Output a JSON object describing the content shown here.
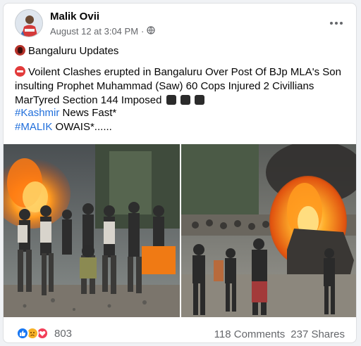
{
  "post": {
    "author": "Malik Ovii",
    "timestamp": "August 12 at 3:04 PM",
    "separator": "·",
    "privacy_icon": "globe-icon",
    "menu_icon": "more-options-icon",
    "title_line": "Bangaluru Updates",
    "body": "Voilent Clashes erupted in Bangaluru Over Post Of BJp MLA's Son insulting Prophet Muhammad (Saw) 60 Cops Injured 2 Civillians MarTyred  Section 144 Imposed",
    "hashtag1": "#Kashmir",
    "hashtag1_rest": " News Fast*",
    "hashtag2": "#MALIK",
    "hashtag2_rest": " OWAIS*......"
  },
  "reactions": {
    "icons": [
      "like-icon",
      "sad-icon",
      "love-icon"
    ],
    "count": "803"
  },
  "stats": {
    "comments": "118 Comments",
    "shares": "237 Shares"
  },
  "colors": {
    "link": "#216fdb",
    "muted": "#65676b",
    "like": "#1877f2",
    "love": "#f33e58",
    "sad": "#f7b125"
  }
}
